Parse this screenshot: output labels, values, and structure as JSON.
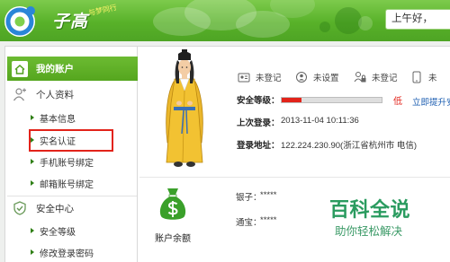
{
  "header": {
    "logo_text": "子高",
    "slogan": "与梦同行",
    "greeting": "上午好，"
  },
  "sidebar": {
    "account_title": "我的账户",
    "account_icon": "home-icon",
    "groups": [
      {
        "title": "个人资料",
        "icon": "person-icon",
        "items": [
          "基本信息",
          "实名认证",
          "手机账号绑定",
          "邮箱账号绑定"
        ]
      },
      {
        "title": "安全中心",
        "icon": "shield-icon",
        "items": [
          "安全等级",
          "修改登录密码"
        ]
      }
    ],
    "highlighted": {
      "group": 0,
      "item": 1
    }
  },
  "profile": {
    "avatar": "scholar-character-avatar",
    "status_items": [
      {
        "icon": "id-card-icon",
        "label": "未登记"
      },
      {
        "icon": "user-badge-icon",
        "label": "未设置"
      },
      {
        "icon": "user-lock-icon",
        "label": "未登记"
      },
      {
        "icon": "phone-icon",
        "label": "未"
      }
    ],
    "security_label": "安全等级：",
    "security_fill": 0.2,
    "security_level_text": "低",
    "upgrade_link": "立即提升安",
    "last_login_label": "上次登录：",
    "last_login_value": "2013-11-04 10:11:36",
    "login_address_label": "登录地址：",
    "login_address_value": "122.224.230.90(浙江省杭州市 电信)"
  },
  "balance": {
    "icon": "money-bag-icon",
    "title": "账户余额",
    "rows": [
      {
        "label": "银子：",
        "value": "*****"
      },
      {
        "label": "通宝：",
        "value": "*****"
      }
    ]
  },
  "watermark": {
    "title": "百科全说",
    "subtitle": "助你轻松解决"
  },
  "colors": {
    "brand_green": "#58b129",
    "nav_green": "#55a61e",
    "alert_red": "#e2231a",
    "link_blue": "#1a5cb0",
    "watermark_green": "#2a9b5f",
    "arrow_green": "#2f7f16",
    "bag_green": "#3aa02a"
  }
}
